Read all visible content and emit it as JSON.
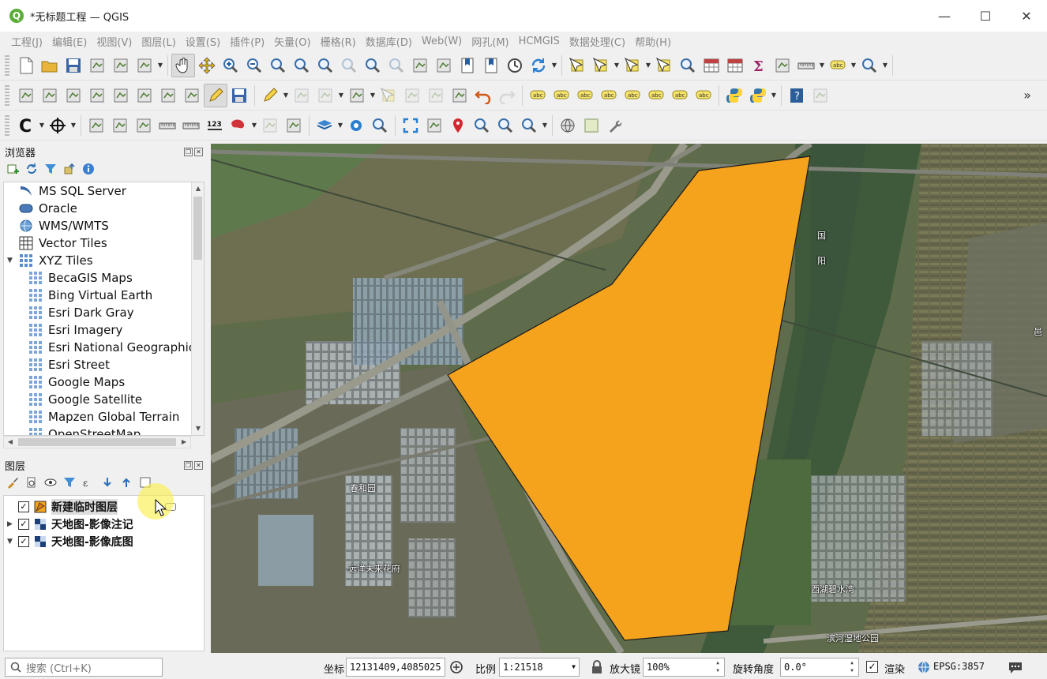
{
  "window": {
    "title": "*无标题工程 — QGIS",
    "app_icon": "Q",
    "controls": {
      "minimize": "—",
      "maximize": "☐",
      "close": "✕"
    }
  },
  "menubar": {
    "items": [
      "工程(J)",
      "编辑(E)",
      "视图(V)",
      "图层(L)",
      "设置(S)",
      "插件(P)",
      "矢量(O)",
      "栅格(R)",
      "数据库(D)",
      "Web(W)",
      "网孔(M)",
      "HCMGIS",
      "数据处理(C)",
      "帮助(H)"
    ]
  },
  "toolbars": {
    "row1": [
      "new-project-icon",
      "open-project-icon",
      "save-project-icon",
      "new-print-layout-icon",
      "layout-manager-icon",
      "style-manager-icon",
      "pan-map-icon",
      "pan-to-selection-icon",
      "zoom-in-icon",
      "zoom-out-icon",
      "zoom-full-icon",
      "zoom-to-selection-icon",
      "zoom-to-layer-icon",
      "zoom-native-icon",
      "zoom-last-icon",
      "zoom-next-icon",
      "new-map-view-icon",
      "new-3d-map-view-icon",
      "new-spatial-bookmark-icon",
      "show-bookmarks-icon",
      "temporal-controller-icon",
      "refresh-icon",
      "select-features-icon",
      "select-by-value-icon",
      "deselect-icon",
      "select-by-expression-icon",
      "identify-features-icon",
      "attribute-table-icon",
      "statistics-icon",
      "sum-icon",
      "field-calculator-icon",
      "measure-line-icon",
      "map-tips-icon",
      "locator-icon"
    ],
    "row2": [
      "data-source-manager-icon",
      "new-geopackage-layer-icon",
      "new-shapefile-layer-icon",
      "new-spatialite-layer-icon",
      "new-temporary-layer-icon",
      "new-virtual-layer-icon",
      "new-mesh-layer-icon",
      "current-edits-icon",
      "toggle-editing-icon",
      "save-edits-icon",
      "digitize-icon",
      "add-polygon-icon",
      "vertex-tool-icon",
      "modify-attributes-icon",
      "delete-selected-icon",
      "cut-features-icon",
      "copy-features-icon",
      "paste-features-icon",
      "undo-icon",
      "redo-icon",
      "label-icon",
      "layer-labeling-icon",
      "diagram-icon",
      "pin-labels-icon",
      "show-hide-labels-icon",
      "move-label-icon",
      "rotate-label-icon",
      "change-label-icon",
      "python-console-icon",
      "python-icon",
      "help-icon",
      "georeferencer-icon"
    ],
    "row3": [
      "hcmgis-icon",
      "crosshair-icon",
      "geocoding-icon",
      "digitize-curve-icon",
      "split-features-icon",
      "measure-icon",
      "ruler-icon",
      "number-icon",
      "shapes-icon",
      "network-icon",
      "topology-icon",
      "layers-icon",
      "settings-icon",
      "search-icon",
      "full-extent-icon",
      "copy-coordinates-icon",
      "pin-icon",
      "zoom-point-icon",
      "zoom-cross-icon",
      "zoom-box-icon",
      "globe-icon",
      "grid-icon",
      "wrench-icon"
    ],
    "more": "»"
  },
  "browser_panel": {
    "title": "浏览器",
    "items": [
      {
        "label": "MS SQL Server",
        "icon": "mssql-icon",
        "level": 0
      },
      {
        "label": "Oracle",
        "icon": "oracle-icon",
        "level": 0
      },
      {
        "label": "WMS/WMTS",
        "icon": "wms-icon",
        "level": 0
      },
      {
        "label": "Vector Tiles",
        "icon": "vector-tiles-icon",
        "level": 0
      },
      {
        "label": "XYZ Tiles",
        "icon": "xyz-tiles-icon",
        "level": 0,
        "expanded": true
      },
      {
        "label": "BecaGIS Maps",
        "icon": "tile-icon",
        "level": 1
      },
      {
        "label": "Bing Virtual Earth",
        "icon": "tile-icon",
        "level": 1
      },
      {
        "label": "Esri Dark Gray",
        "icon": "tile-icon",
        "level": 1
      },
      {
        "label": "Esri Imagery",
        "icon": "tile-icon",
        "level": 1
      },
      {
        "label": "Esri National Geographic",
        "icon": "tile-icon",
        "level": 1
      },
      {
        "label": "Esri Street",
        "icon": "tile-icon",
        "level": 1
      },
      {
        "label": "Google Maps",
        "icon": "tile-icon",
        "level": 1
      },
      {
        "label": "Google Satellite",
        "icon": "tile-icon",
        "level": 1
      },
      {
        "label": "Mapzen Global Terrain",
        "icon": "tile-icon",
        "level": 1
      },
      {
        "label": "OpenStreetMap",
        "icon": "tile-icon",
        "level": 1
      }
    ]
  },
  "layers_panel": {
    "title": "图层",
    "layers": [
      {
        "name": "新建临时图层",
        "checked": true,
        "icon": "polygon-layer-icon",
        "selected": true,
        "expandable": false
      },
      {
        "name": "天地图-影像注记",
        "checked": true,
        "icon": "raster-layer-icon",
        "selected": false,
        "expandable": true,
        "expanded": false
      },
      {
        "name": "天地图-影像底图",
        "checked": true,
        "icon": "raster-layer-icon",
        "selected": false,
        "expandable": true,
        "expanded": true
      }
    ]
  },
  "map": {
    "polygon_fill": "#f5a21c",
    "polygon_stroke": "#1a1a1a",
    "labels": [
      "春和园",
      "远洋未来花府",
      "西湖碧水湾",
      "滨河湿地公园",
      "国",
      "阳",
      "邑"
    ]
  },
  "statusbar": {
    "search_placeholder": "搜索 (Ctrl+K)",
    "coordinate_label": "坐标",
    "coordinate_value": "12131409,4085025",
    "scale_label": "比例",
    "scale_value": "1:21518",
    "magnifier_label": "放大镜",
    "magnifier_value": "100%",
    "rotation_label": "旋转角度",
    "rotation_value": "0.0°",
    "render_label": "渲染",
    "render_checked": true,
    "crs_label": "EPSG:3857"
  }
}
